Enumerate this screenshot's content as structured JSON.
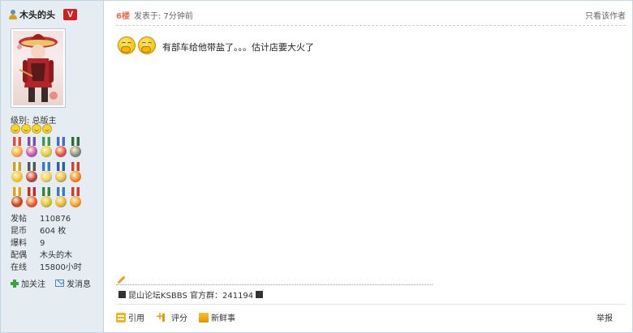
{
  "user": {
    "name": "木头的头",
    "verified_badge": "V",
    "level_label": "级别: 总版主",
    "smiley_count": 4,
    "medal_count": 15,
    "stats": [
      {
        "key": "发帖",
        "value": "110876"
      },
      {
        "key": "昆币",
        "value": "604 枚"
      },
      {
        "key": "爆料",
        "value": "9"
      },
      {
        "key": "配偶",
        "value": "木头的木"
      },
      {
        "key": "在线",
        "value": "15800小时"
      }
    ],
    "follow_label": "加关注",
    "message_label": "发消息"
  },
  "post": {
    "floor": "6楼",
    "posted_at": "发表于: 7分钟前",
    "only_author_label": "只看该作者",
    "text": "有部车给他带盐了。。。估计店要大火了",
    "emoji_icon": "laughing-cover-mouth-emoji"
  },
  "signature": {
    "text": "昆山论坛KSBBS 官方群：241194"
  },
  "footer": {
    "quote_label": "引用",
    "rate_label": "评分",
    "fresh_label": "新鲜事",
    "report_label": "举报"
  },
  "colors": {
    "sidebar_bg": "#e5edf2",
    "border": "#c2d5e3",
    "floor_accent": "#f26c4f",
    "badge_red": "#d51f1f"
  }
}
